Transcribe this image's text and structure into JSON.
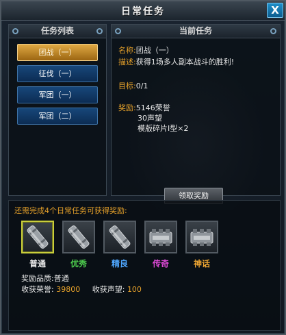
{
  "window": {
    "title": "日常任务",
    "close_glyph": "X"
  },
  "task_list": {
    "heading": "任务列表",
    "items": [
      {
        "label": "团战（一）",
        "active": true
      },
      {
        "label": "征伐（一）",
        "active": false
      },
      {
        "label": "军团（一）",
        "active": false
      },
      {
        "label": "军团（二）",
        "active": false
      }
    ]
  },
  "current_task": {
    "heading": "当前任务",
    "name_label": "名称:",
    "name_value": "团战（一）",
    "desc_label": "描述:",
    "desc_value": "获得1场多人副本战斗的胜利!",
    "goal_label": "目标:",
    "goal_value": "0/1",
    "reward_label": "奖励:",
    "reward_lines": [
      "5146荣誉",
      "30声望",
      "模版碎片Ⅰ型×2"
    ],
    "claim_button": "领取奖励"
  },
  "bonus": {
    "hint": "还需完成4个日常任务可获得奖励:",
    "tiers": [
      {
        "label": "普通",
        "color": "#e8e8e8",
        "icon": "cylinder-shell-icon",
        "selected": true
      },
      {
        "label": "优秀",
        "color": "#4fd14f",
        "icon": "cylinder-shell-icon",
        "selected": false
      },
      {
        "label": "精良",
        "color": "#4fa7ff",
        "icon": "cylinder-shell-icon",
        "selected": false
      },
      {
        "label": "传奇",
        "color": "#e04bd8",
        "icon": "machine-module-icon",
        "selected": false
      },
      {
        "label": "神话",
        "color": "#f0a733",
        "icon": "machine-module-icon",
        "selected": false
      }
    ],
    "quality_label": "奖励品质:",
    "quality_value": "普通",
    "honor_label": "收获荣誉:",
    "honor_value": "39800",
    "fame_label": "收获声望:",
    "fame_value": "100"
  }
}
